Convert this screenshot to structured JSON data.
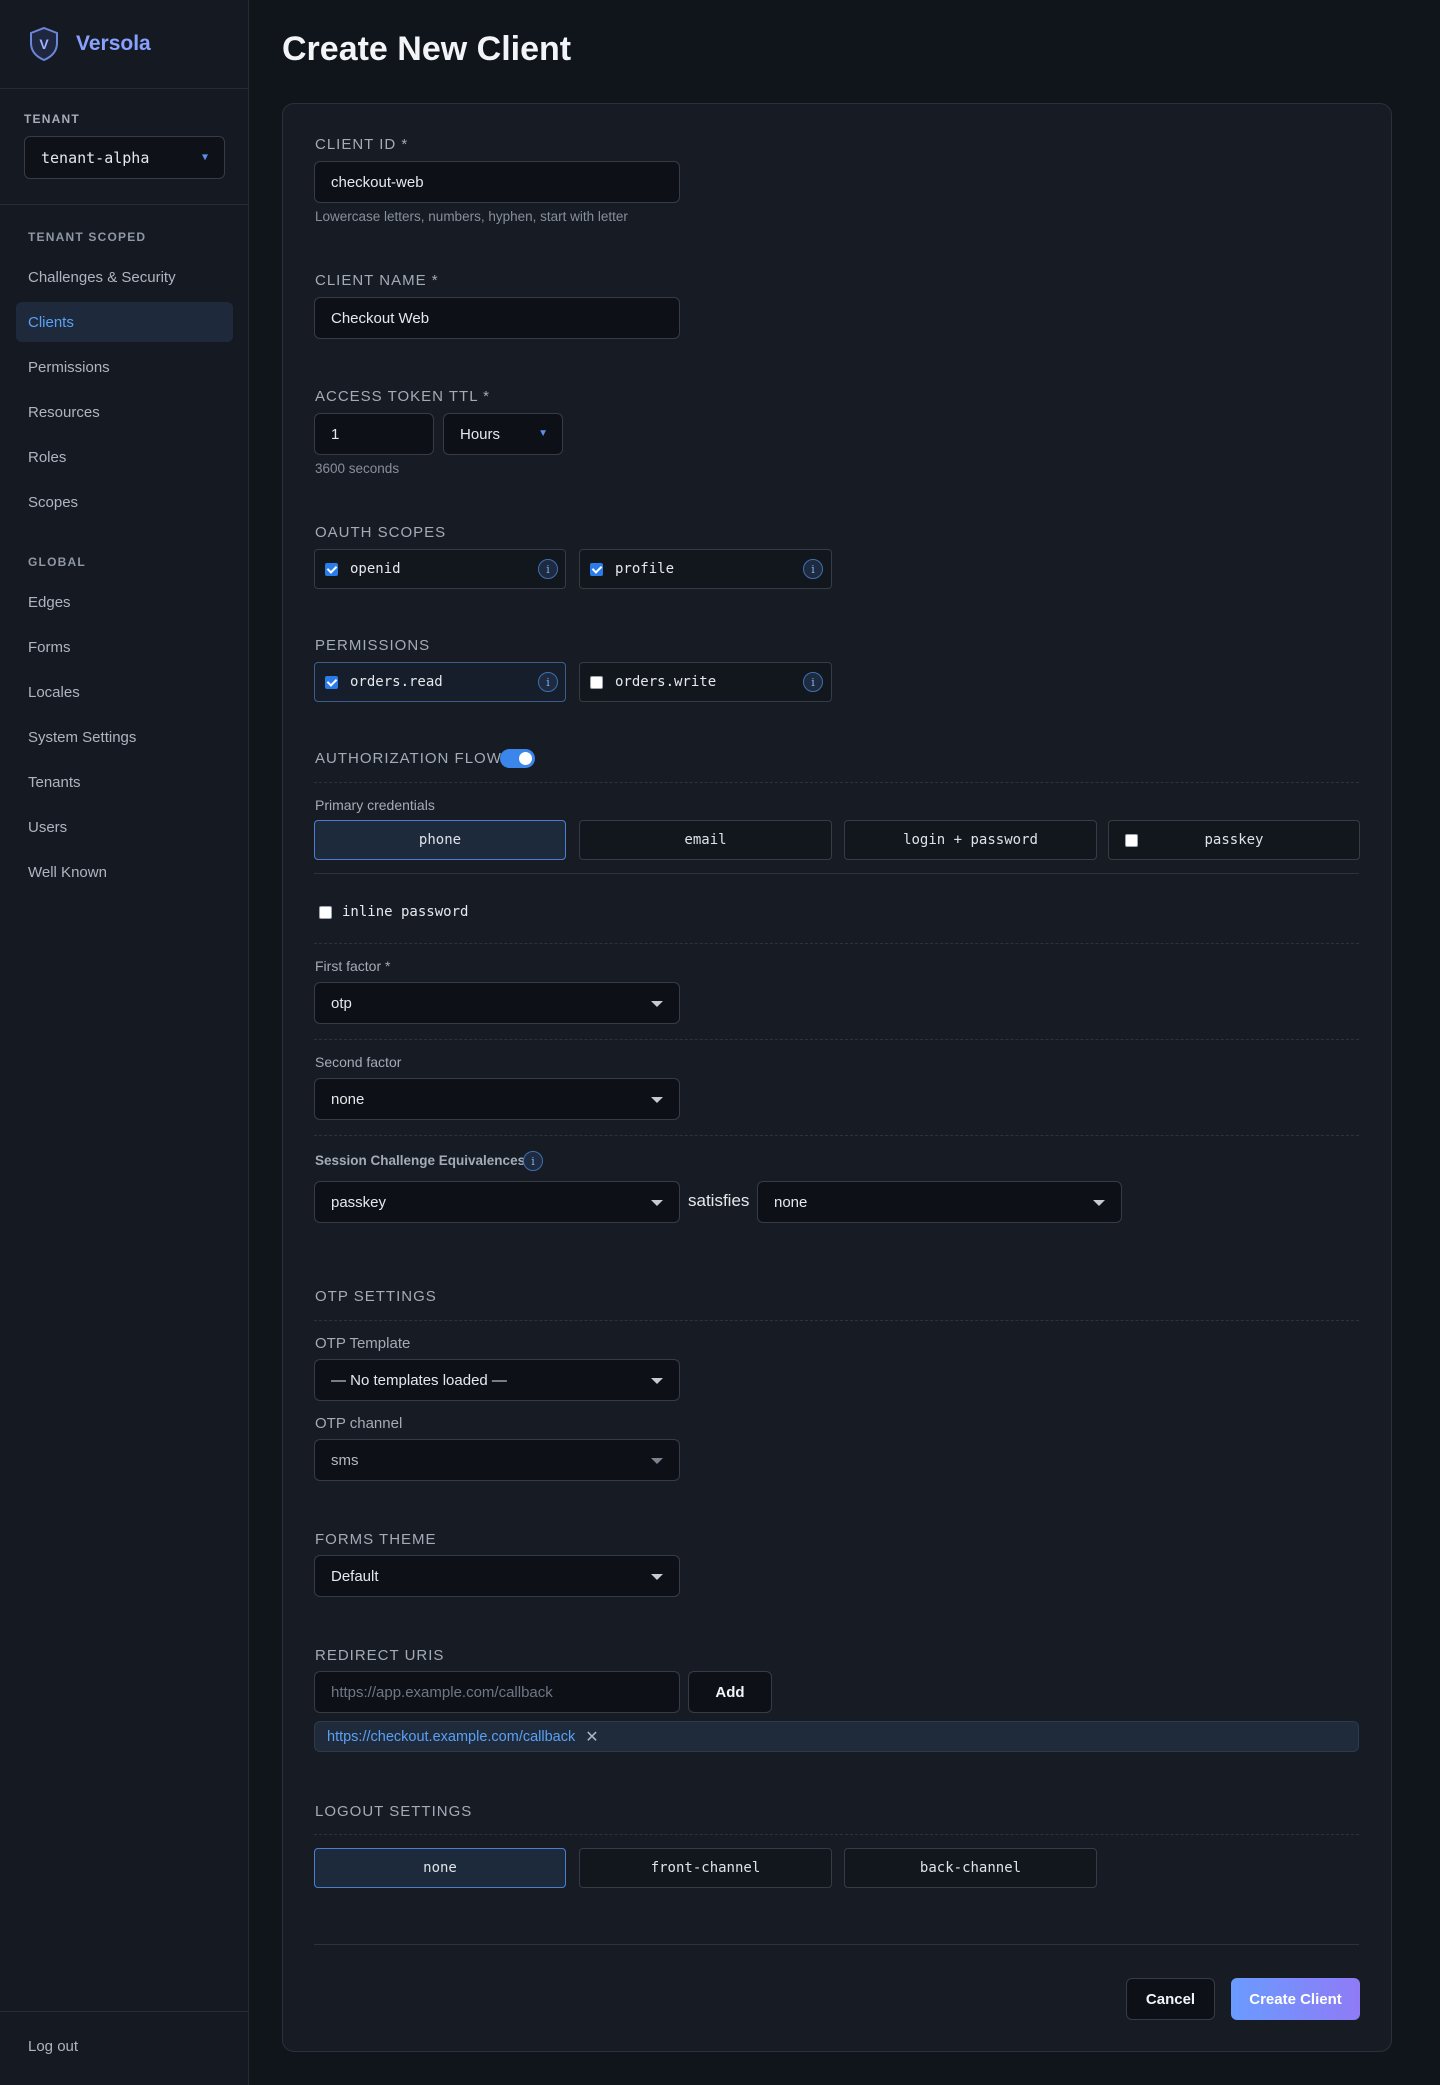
{
  "app": {
    "name": "Versola",
    "logo_letter": "V",
    "accent": "#8aa0ff"
  },
  "sidebar": {
    "tenant_label": "TENANT",
    "tenant_value": "tenant-alpha",
    "tenant_scoped_label": "TENANT SCOPED",
    "tenant_scoped_items": [
      {
        "label": "Challenges & Security"
      },
      {
        "label": "Clients",
        "active": true
      },
      {
        "label": "Permissions"
      },
      {
        "label": "Resources"
      },
      {
        "label": "Roles"
      },
      {
        "label": "Scopes"
      }
    ],
    "global_label": "GLOBAL",
    "global_items": [
      {
        "label": "Edges"
      },
      {
        "label": "Forms"
      },
      {
        "label": "Locales"
      },
      {
        "label": "System Settings"
      },
      {
        "label": "Tenants"
      },
      {
        "label": "Users"
      },
      {
        "label": "Well Known"
      }
    ],
    "logout_label": "Log out"
  },
  "page": {
    "title": "Create New Client"
  },
  "form": {
    "client_id": {
      "label": "CLIENT ID *",
      "value": "checkout-web",
      "hint": "Lowercase letters, numbers, hyphen, start with letter"
    },
    "client_name": {
      "label": "CLIENT NAME *",
      "value": "Checkout Web"
    },
    "ttl": {
      "label": "ACCESS TOKEN TTL *",
      "value": "1",
      "unit": "Hours",
      "hint": "3600 seconds"
    },
    "oauth_scopes": {
      "label": "OAUTH SCOPES",
      "items": [
        {
          "label": "openid",
          "checked": true
        },
        {
          "label": "profile",
          "checked": true
        }
      ]
    },
    "permissions": {
      "label": "PERMISSIONS",
      "items": [
        {
          "label": "orders.read",
          "checked": true
        },
        {
          "label": "orders.write",
          "checked": false
        }
      ]
    },
    "auth_flow": {
      "label": "AUTHORIZATION FLOW",
      "enabled": true,
      "primary_label": "Primary credentials",
      "primary_options": [
        {
          "label": "phone",
          "selected": true
        },
        {
          "label": "email"
        },
        {
          "label": "login + password"
        },
        {
          "label": "passkey",
          "checkbox": true
        }
      ],
      "inline_password_label": "inline password",
      "first_factor_label": "First factor *",
      "first_factor_value": "otp",
      "second_factor_label": "Second factor",
      "second_factor_value": "none",
      "equivalences_label": "Session Challenge Equivalences",
      "equivalence_left": "passkey",
      "equivalence_word": "satisfies",
      "equivalence_right": "none"
    },
    "otp": {
      "label": "OTP SETTINGS",
      "template_label": "OTP Template",
      "template_value": "— No templates loaded —",
      "channel_label": "OTP channel",
      "channel_value": "sms"
    },
    "forms_theme": {
      "label": "FORMS THEME",
      "value": "Default"
    },
    "redirect_uris": {
      "label": "REDIRECT URIS",
      "placeholder": "https://app.example.com/callback",
      "add_label": "Add",
      "items": [
        "https://checkout.example.com/callback"
      ]
    },
    "logout_settings": {
      "label": "LOGOUT SETTINGS",
      "options": [
        {
          "label": "none",
          "selected": true
        },
        {
          "label": "front-channel"
        },
        {
          "label": "back-channel"
        }
      ]
    },
    "actions": {
      "cancel_label": "Cancel",
      "submit_label": "Create Client"
    }
  }
}
